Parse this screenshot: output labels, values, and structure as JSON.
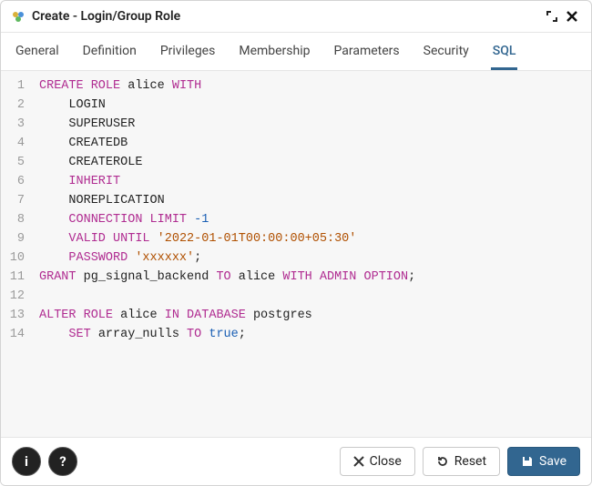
{
  "titlebar": {
    "title": "Create - Login/Group Role"
  },
  "tabs": [
    {
      "label": "General",
      "active": false
    },
    {
      "label": "Definition",
      "active": false
    },
    {
      "label": "Privileges",
      "active": false
    },
    {
      "label": "Membership",
      "active": false
    },
    {
      "label": "Parameters",
      "active": false
    },
    {
      "label": "Security",
      "active": false
    },
    {
      "label": "SQL",
      "active": true
    }
  ],
  "buttons": {
    "close_label": "Close",
    "reset_label": "Reset",
    "save_label": "Save"
  },
  "sql": {
    "lines": [
      [
        {
          "t": "CREATE ROLE",
          "c": "kw"
        },
        {
          "t": " alice ",
          "c": ""
        },
        {
          "t": "WITH",
          "c": "kw"
        }
      ],
      [
        {
          "t": "    LOGIN",
          "c": ""
        }
      ],
      [
        {
          "t": "    SUPERUSER",
          "c": ""
        }
      ],
      [
        {
          "t": "    CREATEDB",
          "c": ""
        }
      ],
      [
        {
          "t": "    CREATEROLE",
          "c": ""
        }
      ],
      [
        {
          "t": "    ",
          "c": ""
        },
        {
          "t": "INHERIT",
          "c": "kw"
        }
      ],
      [
        {
          "t": "    NOREPLICATION",
          "c": ""
        }
      ],
      [
        {
          "t": "    ",
          "c": ""
        },
        {
          "t": "CONNECTION LIMIT",
          "c": "kw"
        },
        {
          "t": " ",
          "c": ""
        },
        {
          "t": "-1",
          "c": "num"
        }
      ],
      [
        {
          "t": "    ",
          "c": ""
        },
        {
          "t": "VALID UNTIL",
          "c": "kw"
        },
        {
          "t": " ",
          "c": ""
        },
        {
          "t": "'2022-01-01T00:00:00+05:30'",
          "c": "str"
        }
      ],
      [
        {
          "t": "    ",
          "c": ""
        },
        {
          "t": "PASSWORD",
          "c": "kw"
        },
        {
          "t": " ",
          "c": ""
        },
        {
          "t": "'xxxxxx'",
          "c": "str"
        },
        {
          "t": ";",
          "c": ""
        }
      ],
      [
        {
          "t": "GRANT",
          "c": "kw"
        },
        {
          "t": " pg_signal_backend ",
          "c": ""
        },
        {
          "t": "TO",
          "c": "kw"
        },
        {
          "t": " alice ",
          "c": ""
        },
        {
          "t": "WITH ADMIN OPTION",
          "c": "kw"
        },
        {
          "t": ";",
          "c": ""
        }
      ],
      [],
      [
        {
          "t": "ALTER ROLE",
          "c": "kw"
        },
        {
          "t": " alice ",
          "c": ""
        },
        {
          "t": "IN DATABASE",
          "c": "kw"
        },
        {
          "t": " postgres",
          "c": ""
        }
      ],
      [
        {
          "t": "    ",
          "c": ""
        },
        {
          "t": "SET",
          "c": "kw"
        },
        {
          "t": " array_nulls ",
          "c": ""
        },
        {
          "t": "TO",
          "c": "kw"
        },
        {
          "t": " ",
          "c": ""
        },
        {
          "t": "true",
          "c": "num"
        },
        {
          "t": ";",
          "c": ""
        }
      ]
    ]
  }
}
